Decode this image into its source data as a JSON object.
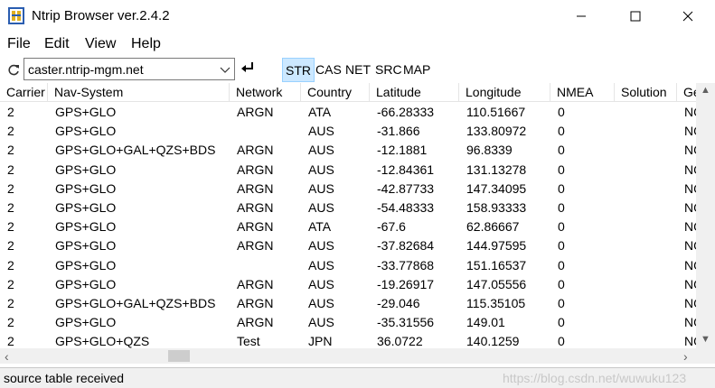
{
  "window": {
    "title": "Ntrip Browser ver.2.4.2"
  },
  "menu": {
    "file": "File",
    "edit": "Edit",
    "view": "View",
    "help": "Help"
  },
  "toolbar": {
    "address": "caster.ntrip-mgm.net",
    "tabs": [
      "STR",
      "CAS",
      "NET",
      "SRC",
      "MAP"
    ],
    "active_tab": "STR"
  },
  "table": {
    "columns": [
      "Carrier",
      "Nav-System",
      "Network",
      "Country",
      "Latitude",
      "Longitude",
      "NMEA",
      "Solution",
      "Ge"
    ],
    "rows": [
      [
        "2",
        "GPS+GLO",
        "ARGN",
        "ATA",
        "-66.28333",
        "110.51667",
        "0",
        "",
        "NO"
      ],
      [
        "2",
        "GPS+GLO",
        "",
        "AUS",
        "-31.866",
        "133.80972",
        "0",
        "",
        "NO"
      ],
      [
        "2",
        "GPS+GLO+GAL+QZS+BDS",
        "ARGN",
        "AUS",
        "-12.1881",
        "96.8339",
        "0",
        "",
        "NO"
      ],
      [
        "2",
        "GPS+GLO",
        "ARGN",
        "AUS",
        "-12.84361",
        "131.13278",
        "0",
        "",
        "NO"
      ],
      [
        "2",
        "GPS+GLO",
        "ARGN",
        "AUS",
        "-42.87733",
        "147.34095",
        "0",
        "",
        "NO"
      ],
      [
        "2",
        "GPS+GLO",
        "ARGN",
        "AUS",
        "-54.48333",
        "158.93333",
        "0",
        "",
        "NO"
      ],
      [
        "2",
        "GPS+GLO",
        "ARGN",
        "ATA",
        "-67.6",
        "62.86667",
        "0",
        "",
        "NO"
      ],
      [
        "2",
        "GPS+GLO",
        "ARGN",
        "AUS",
        "-37.82684",
        "144.97595",
        "0",
        "",
        "NO"
      ],
      [
        "2",
        "GPS+GLO",
        "",
        "AUS",
        "-33.77868",
        "151.16537",
        "0",
        "",
        "NO"
      ],
      [
        "2",
        "GPS+GLO",
        "ARGN",
        "AUS",
        "-19.26917",
        "147.05556",
        "0",
        "",
        "NO"
      ],
      [
        "2",
        "GPS+GLO+GAL+QZS+BDS",
        "ARGN",
        "AUS",
        "-29.046",
        "115.35105",
        "0",
        "",
        "NO"
      ],
      [
        "2",
        "GPS+GLO",
        "ARGN",
        "AUS",
        "-35.31556",
        "149.01",
        "0",
        "",
        "NO"
      ],
      [
        "2",
        "GPS+GLO+QZS",
        "Test",
        "JPN",
        "36.0722",
        "140.1259",
        "0",
        "",
        "NO"
      ]
    ]
  },
  "status": {
    "text": "source table received",
    "watermark": "https://blog.csdn.net/wuwuku123"
  },
  "colors": {
    "accent": "#cce8ff",
    "accent_border": "#99d1ff"
  }
}
